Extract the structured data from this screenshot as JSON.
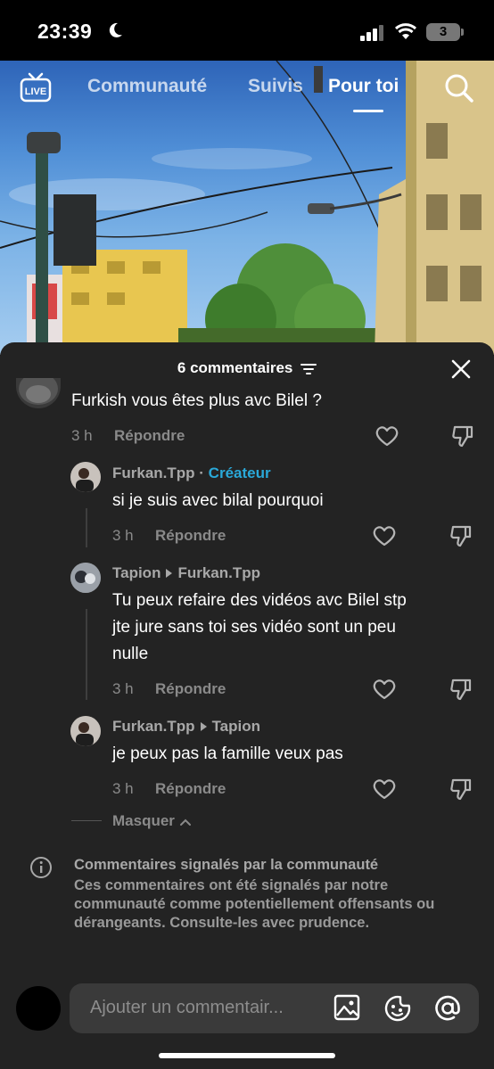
{
  "status_bar": {
    "time": "23:39",
    "battery": "3"
  },
  "nav": {
    "live_label": "LIVE",
    "tabs": [
      {
        "label": "Communauté",
        "active": false
      },
      {
        "label": "Suivis",
        "active": false
      },
      {
        "label": "Pour toi",
        "active": true
      }
    ]
  },
  "comments_sheet": {
    "title": "6 commentaires",
    "comments": [
      {
        "author": "",
        "text": "Furkish vous êtes plus avc Bilel ?",
        "time": "3 h",
        "reply_label": "Répondre"
      },
      {
        "author": "Furkan.Tpp",
        "badge": "Créateur",
        "text": "si je suis avec bilal pourquoi",
        "time": "3 h",
        "reply_label": "Répondre"
      },
      {
        "author": "Tapion",
        "reply_to": "Furkan.Tpp",
        "text_lines": [
          "Tu peux refaire des vidéos avc Bilel stp",
          "jte jure sans toi ses vidéo sont un peu",
          "nulle"
        ],
        "time": "3 h",
        "reply_label": "Répondre"
      },
      {
        "author": "Furkan.Tpp",
        "reply_to": "Tapion",
        "text": "je peux pas la famille veux pas",
        "time": "3 h",
        "reply_label": "Répondre"
      }
    ],
    "hide_label": "Masquer",
    "notice": {
      "title": "Commentaires signalés par la communauté",
      "body": "Ces commentaires ont été signalés par notre communauté comme potentiellement offensants ou dérangeants. Consulte-les avec prudence."
    },
    "composer": {
      "placeholder": "Ajouter un commentair..."
    }
  },
  "colors": {
    "sheet_bg": "#232323",
    "creator_badge": "#2aa8d8",
    "muted_text": "#8a8a8a"
  },
  "icons": [
    "moon-icon",
    "signal-icon",
    "wifi-icon",
    "battery-icon",
    "live-icon",
    "search-icon",
    "sort-icon",
    "close-icon",
    "heart-icon",
    "dislike-icon",
    "chevron-up-icon",
    "info-icon",
    "image-icon",
    "emoji-icon",
    "at-icon"
  ]
}
